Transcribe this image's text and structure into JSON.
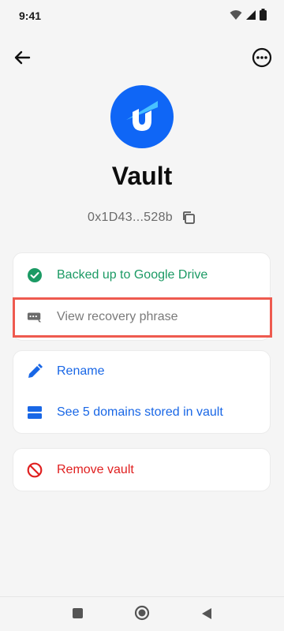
{
  "status_bar": {
    "time": "9:41",
    "icons": [
      "wifi-icon",
      "signal-icon",
      "battery-icon"
    ]
  },
  "top_bar": {
    "back_icon": "arrow-left-icon",
    "more_icon": "more-horizontal-circle-icon"
  },
  "vault": {
    "logo": "unstoppable-domains-logo",
    "title": "Vault",
    "address": "0x1D43...528b",
    "copy_icon": "copy-icon"
  },
  "security_card": {
    "backup_label": "Backed up to Google Drive",
    "backup_icon": "check-circle-icon",
    "recovery_label": "View recovery phrase",
    "recovery_icon": "key-icon"
  },
  "manage_card": {
    "rename_label": "Rename",
    "rename_icon": "pencil-icon",
    "domains_label": "See 5 domains stored in vault",
    "domains_icon": "storage-icon"
  },
  "danger_card": {
    "remove_label": "Remove vault",
    "remove_icon": "block-icon"
  },
  "nav_bar": {
    "items": [
      "recents-square-icon",
      "home-circle-icon",
      "back-triangle-icon"
    ]
  },
  "colors": {
    "accent_blue": "#1967e6",
    "success_green": "#1b9a64",
    "danger_red": "#e02020",
    "highlight": "#ee5a4f",
    "logo_blue": "#0f66f6"
  }
}
